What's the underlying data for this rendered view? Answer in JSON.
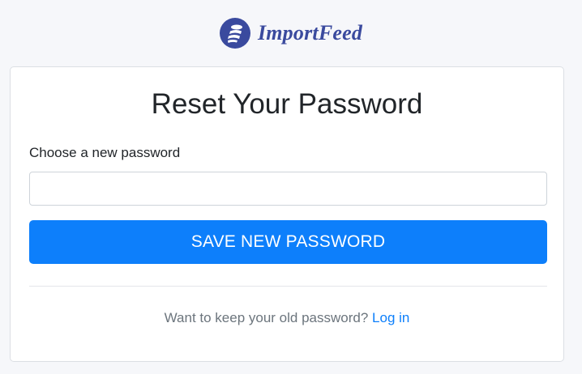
{
  "brand": {
    "name": "ImportFeed",
    "logo_icon": "coin-stack-icon",
    "color": "#3a4a9e"
  },
  "card": {
    "title": "Reset Your Password",
    "password_label": "Choose a new password",
    "password_value": "",
    "save_button_label": "SAVE NEW PASSWORD",
    "footer_prompt": "Want to keep your old password?",
    "login_link_label": "Log in"
  },
  "colors": {
    "accent": "#0d7ffb",
    "background": "#f6f7fa"
  }
}
